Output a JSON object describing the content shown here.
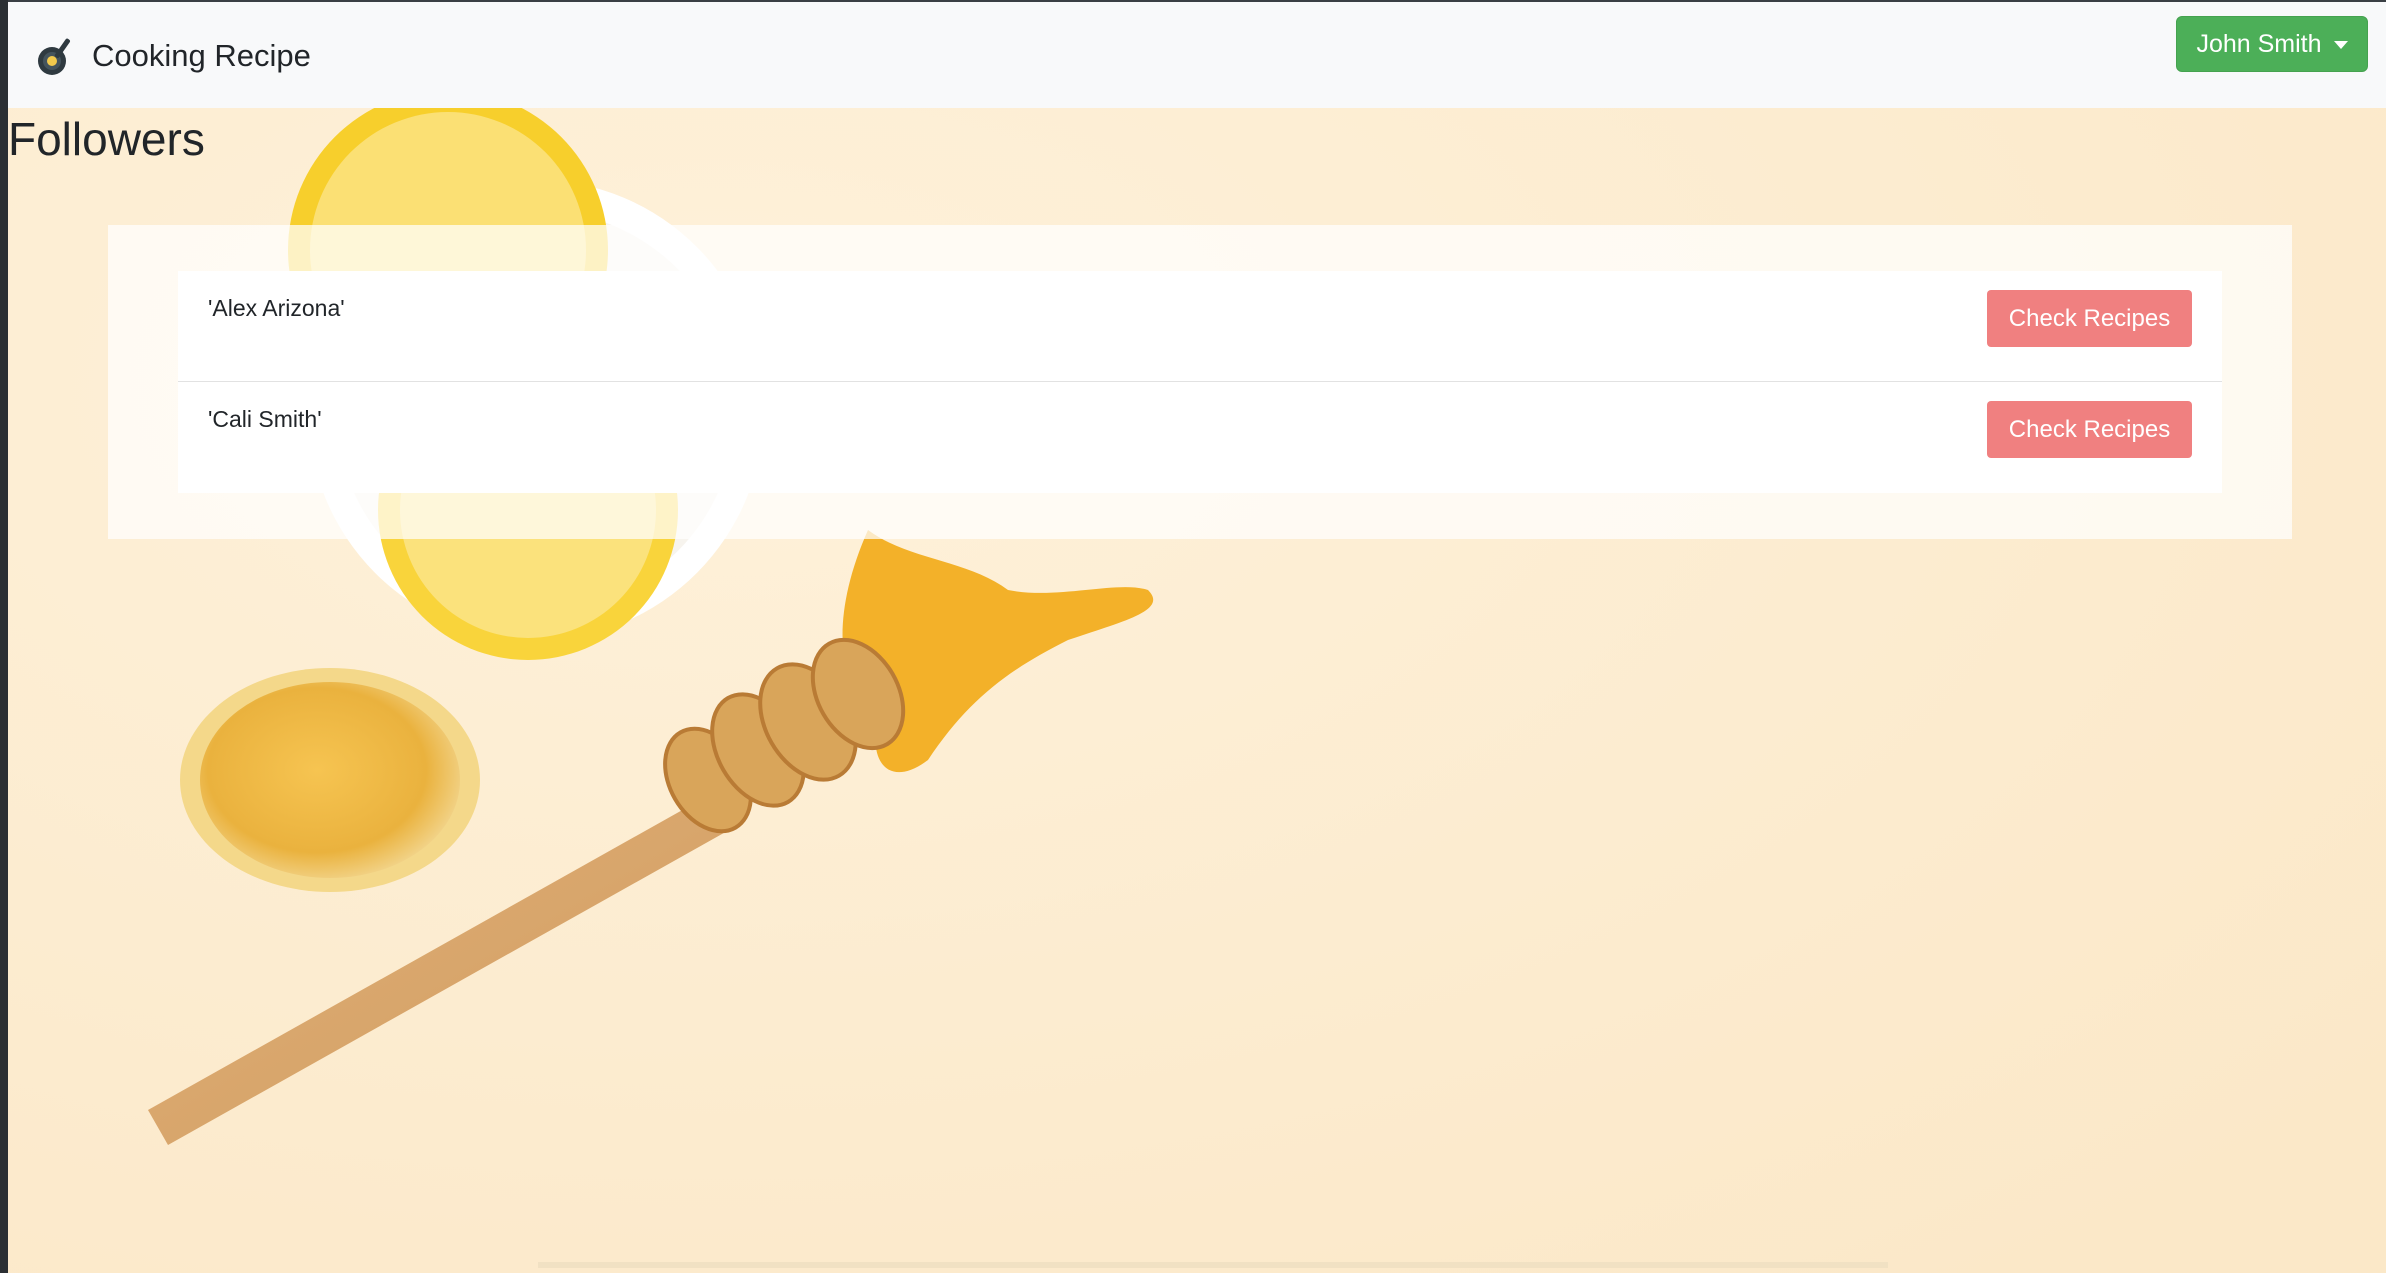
{
  "navbar": {
    "brand_label": "Cooking Recipe",
    "brand_icon": "frying-pan-icon",
    "user_menu_label": "John Smith",
    "user_menu_icon": "caret-down-icon",
    "user_menu_color": "#4caf58"
  },
  "main": {
    "title": "Followers",
    "followers": [
      {
        "name": "'Alex Arizona'",
        "action_label": "Check Recipes"
      },
      {
        "name": "'Cali Smith'",
        "action_label": "Check Recipes"
      }
    ],
    "action_color": "#f08080"
  },
  "background": {
    "description_icon": "honey-lemon-background-image",
    "color": "#fdf0d8"
  }
}
